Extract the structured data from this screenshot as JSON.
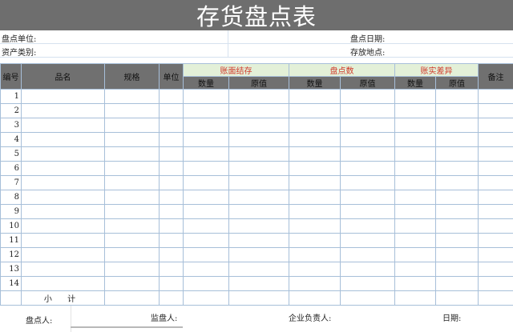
{
  "title": "存货盘点表",
  "info": {
    "row1_left": "盘点单位:",
    "row1_right": "盘点日期:",
    "row2_left": "资产类别:",
    "row2_right": "存放地点:"
  },
  "headers": {
    "no": "编号",
    "name": "品名",
    "spec": "规格",
    "unit": "单位",
    "book": "账面结存",
    "count": "盘点数",
    "diff": "账实差异",
    "remark": "备注",
    "qty": "数量",
    "value": "原值"
  },
  "rows": [
    "1",
    "2",
    "3",
    "4",
    "5",
    "6",
    "7",
    "8",
    "9",
    "10",
    "11",
    "12",
    "13",
    "14"
  ],
  "subtotal": "小 计",
  "footer": {
    "counter": "盘点人:",
    "supervisor": "监盘人:",
    "manager": "企业负责人:",
    "date": "日期:"
  }
}
